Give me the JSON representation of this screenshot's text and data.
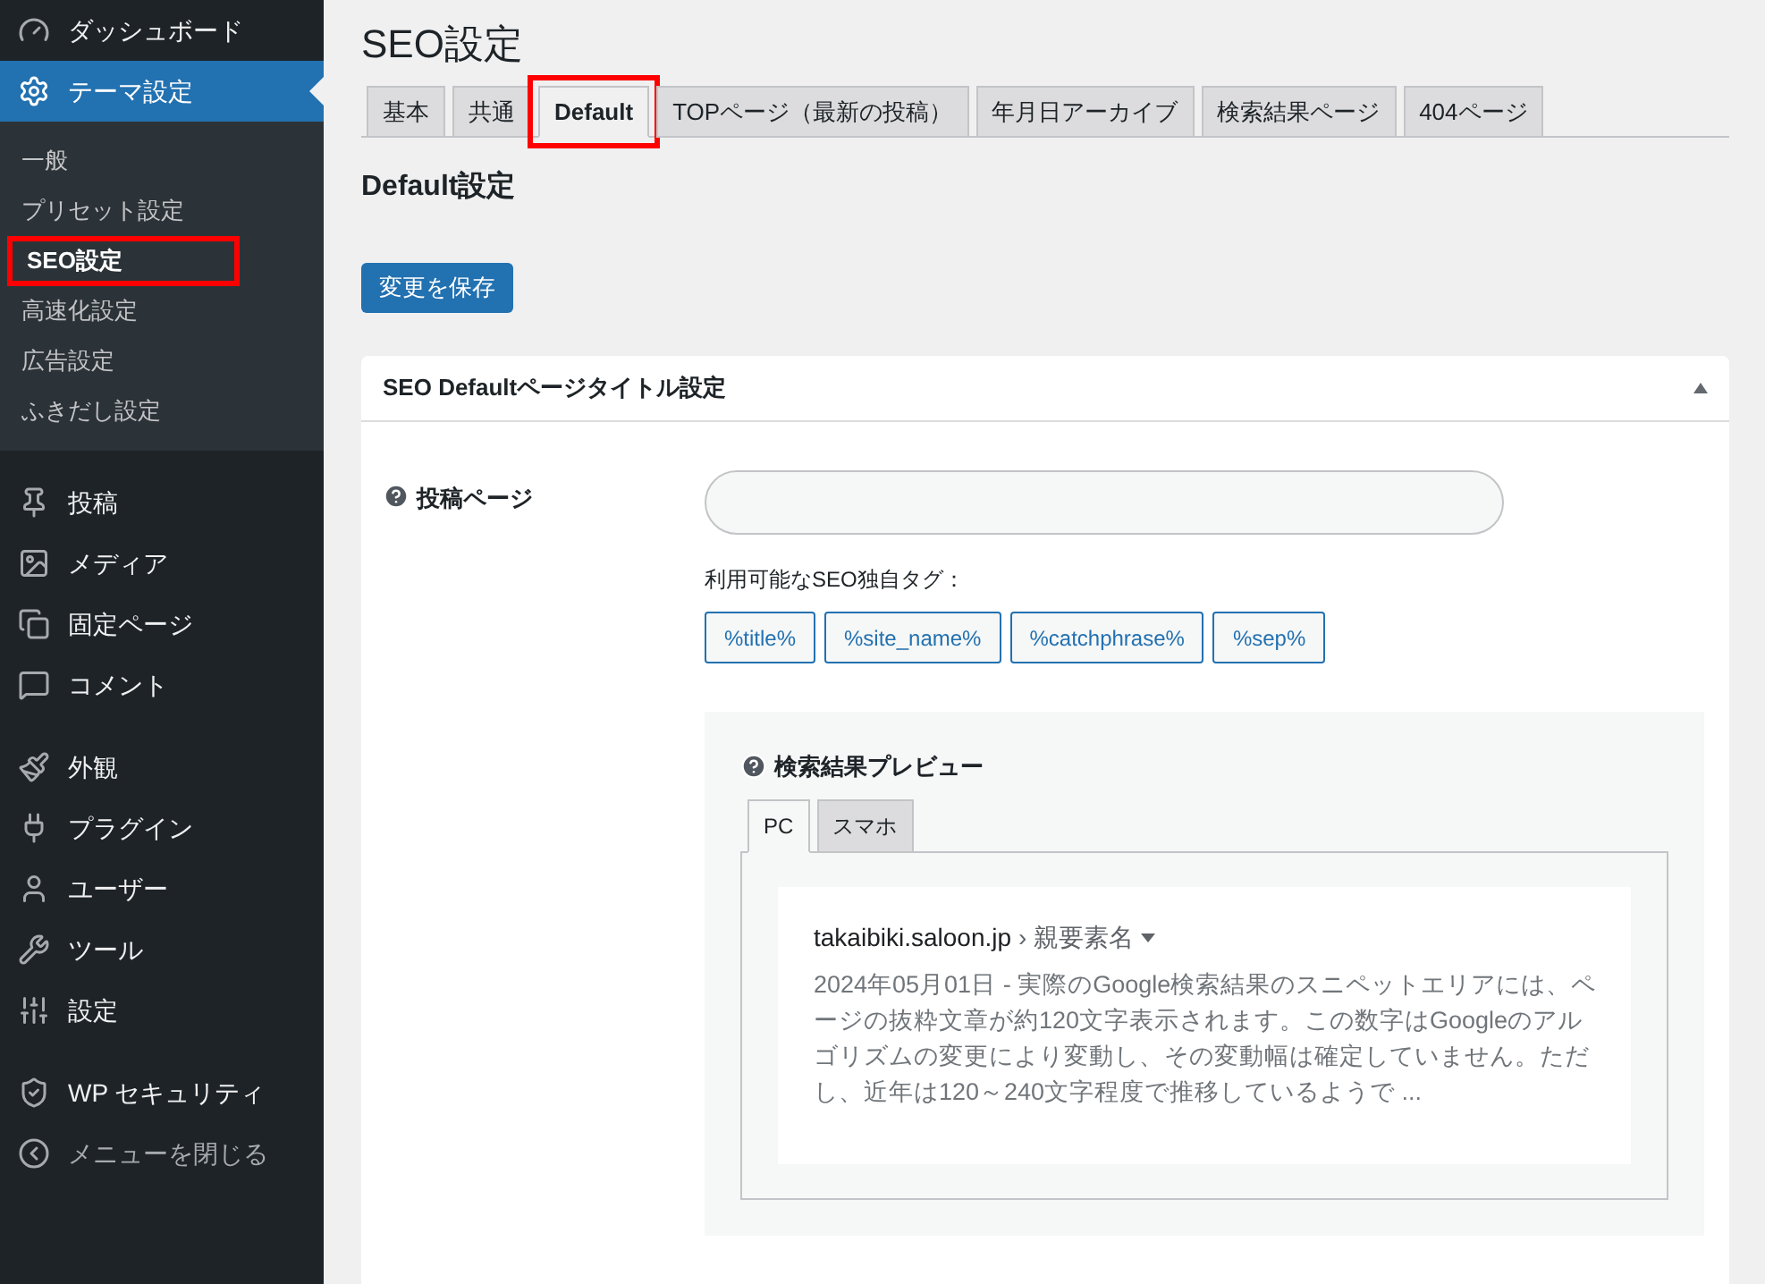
{
  "sidebar": {
    "groups": [
      [
        {
          "label": "ダッシュボード",
          "selected": false
        },
        {
          "label": "テーマ設定",
          "selected": true,
          "children": [
            {
              "label": "一般",
              "selected": false,
              "highlighted": false
            },
            {
              "label": "プリセット設定",
              "selected": false,
              "highlighted": false
            },
            {
              "label": "SEO設定",
              "selected": true,
              "highlighted": true
            },
            {
              "label": "高速化設定",
              "selected": false,
              "highlighted": false
            },
            {
              "label": "広告設定",
              "selected": false,
              "highlighted": false
            },
            {
              "label": "ふきだし設定",
              "selected": false,
              "highlighted": false
            }
          ]
        }
      ],
      [
        {
          "label": "投稿",
          "selected": false
        },
        {
          "label": "メディア",
          "selected": false
        },
        {
          "label": "固定ページ",
          "selected": false
        },
        {
          "label": "コメント",
          "selected": false
        }
      ],
      [
        {
          "label": "外観",
          "selected": false
        },
        {
          "label": "プラグイン",
          "selected": false
        },
        {
          "label": "ユーザー",
          "selected": false
        },
        {
          "label": "ツール",
          "selected": false
        },
        {
          "label": "設定",
          "selected": false
        }
      ],
      [
        {
          "label": "WP セキュリティ",
          "selected": false
        }
      ]
    ],
    "collapse_label": "メニューを閉じる"
  },
  "page_title": "SEO設定",
  "tabs": [
    {
      "label": "基本",
      "selected": false,
      "highlighted": false
    },
    {
      "label": "共通",
      "selected": false,
      "highlighted": false
    },
    {
      "label": "Default",
      "selected": true,
      "highlighted": true
    },
    {
      "label": "TOPページ（最新の投稿）",
      "selected": false,
      "highlighted": false
    },
    {
      "label": "年月日アーカイブ",
      "selected": false,
      "highlighted": false
    },
    {
      "label": "検索結果ページ",
      "selected": false,
      "highlighted": false
    },
    {
      "label": "404ページ",
      "selected": false,
      "highlighted": false
    }
  ],
  "section_title": "Default設定",
  "save_button": "変更を保存",
  "panel": {
    "title": "SEO Defaultページタイトル設定",
    "expanded": true,
    "field_label": "投稿ページ",
    "tags_label": "利用可能なSEO独自タグ：",
    "tags": [
      "%title%",
      "%site_name%",
      "%catchphrase%",
      "%sep%"
    ],
    "preview": {
      "title": "検索結果プレビュー",
      "tabs": [
        {
          "label": "PC",
          "selected": true
        },
        {
          "label": "スマホ",
          "selected": false
        }
      ],
      "url": "takaibiki.saloon.jp",
      "breadcrumb": "› 親要素名",
      "date": "2024年05月01日",
      "snippet": " - 実際のGoogle検索結果のスニペットエリアには、ページの抜粋文章が約120文字表示されます。この数字はGoogleのアルゴリズムの変更により変動し、その変動幅は確定していません。ただし、近年は120～240文字程度で推移しているようで ..."
    }
  }
}
